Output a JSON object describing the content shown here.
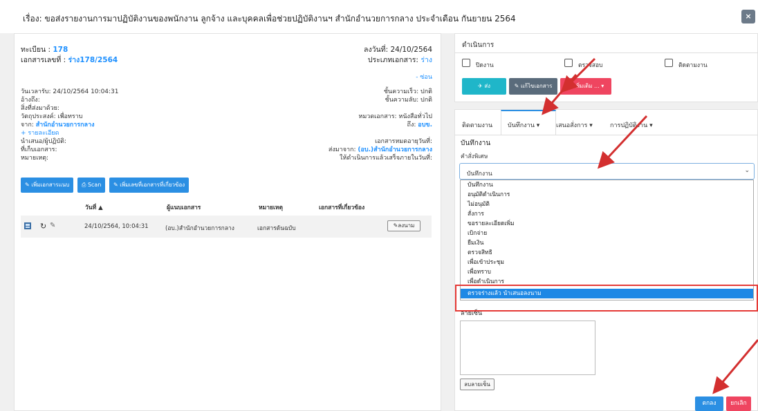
{
  "modal": {
    "title": "เรื่อง: ขอส่งรายงานการมาปฏิบัติงานของพนักงาน ลูกจ้าง และบุคคลเพื่อช่วยปฏิบัติงานฯ สำนักอำนวยการกลาง ประจำเดือน กันยายน 2564",
    "close_label": "×"
  },
  "doc": {
    "reg_label": "ทะเบียน :",
    "reg_value": "178",
    "docno_label": "เอกสารเลขที่ :",
    "docno_value": "ร่าง178/2564",
    "date_label": "ลงวันที่: 24/10/2564",
    "type_label": "ประเภทเอกสาร:",
    "type_value": "ร่าง",
    "hide_link": "- ซ่อน",
    "received": "วันเวลารับ: 24/10/2564 10:04:31",
    "ref": "อ้างถึง:",
    "attach": "สิ่งที่ส่งมาด้วย:",
    "purpose": "วัตถุประสงค์: เพื่อทราบ",
    "from_label": "จาก:",
    "from_value": "สำนักอำนวยการกลาง",
    "detail_link": "+ รายละเอียด",
    "proposer": "นำเสนอ/ผู้ปฏิบัติ:",
    "storage": "ที่เก็บเอกสาร:",
    "note": "หมายเหตุ:",
    "speed": "ชั้นความเร็ว: ปกติ",
    "secret": "ชั้นความลับ: ปกติ",
    "category": "หมวดเอกสาร: หนังสือทั่วไป",
    "to_label": "ถึง:",
    "to_value": "อบข.",
    "expire": "เอกสารหมดอายุวันที่:",
    "sent_from_label": "ส่งมาจาก:",
    "sent_from_value": "(อบ.)สำนักอำนวยการกลาง",
    "due": "ให้ดำเนินการแล้วเสร็จภายในวันที่:"
  },
  "buttons": {
    "add_attachment": "✎ เพิ่มเอกสารแนบ",
    "scan": "⎙ Scan",
    "add_related": "✎ เพิ่มเลขที่เอกสารที่เกี่ยวข้อง"
  },
  "table": {
    "headers": [
      "วันที่ ▲",
      "ผู้แนบเอกสาร",
      "หมายเหตุ",
      "เอกสารที่เกี่ยวข้อง"
    ],
    "rows": [
      {
        "date": "24/10/2564, 10:04:31",
        "attacher": "(อบ.)สำนักอำนวยการกลาง",
        "note": "เอกสารต้นฉบับ",
        "sign_label": "✎ลงนาม"
      }
    ]
  },
  "actions": {
    "title": "ดำเนินการ",
    "checks": [
      "ปิดงาน",
      "ตรวจสอบ",
      "ติดตามงาน"
    ],
    "send": "✈ ส่ง",
    "edit": "✎ แก้ไขเอกสาร",
    "more": "+ เพิ่มเติม ... ▾"
  },
  "tabs": [
    "ติดตามงาน",
    "บันทึกงาน ▾",
    "เสนอสั่งการ ▾",
    "การปฏิบัติงาน ▾"
  ],
  "memo": {
    "title": "บันทึกงาน",
    "sub": "คำสั่งพิเศษ",
    "select_value": "บันทึกงาน",
    "options": [
      "บันทึกงาน",
      "อนุมัติดำเนินการ",
      "ไม่อนุมัติ",
      "สั่งการ",
      "ขอรายละเอียดเพิ่ม",
      "เบิกจ่าย",
      "ยืมเงิน",
      "ตรวจสิทธิ",
      "เพื่อเข้าประชุม",
      "เพื่อทราบ",
      "เพื่อดำเนินการ",
      "ตรวจร่างแล้ว นำเสนอลงนาม"
    ],
    "selected_index": 11,
    "signature_label": "ลายเซ็น",
    "clear_signature": "ลบลายเซ็น"
  },
  "footer": {
    "ok": "ตกลง",
    "cancel": "ยกเลิก"
  },
  "colors": {
    "primary": "#2b8fe3",
    "teal": "#1fb6c9",
    "slate": "#5a6b7b",
    "danger": "#ef4560",
    "annotation": "#d32f2f"
  }
}
